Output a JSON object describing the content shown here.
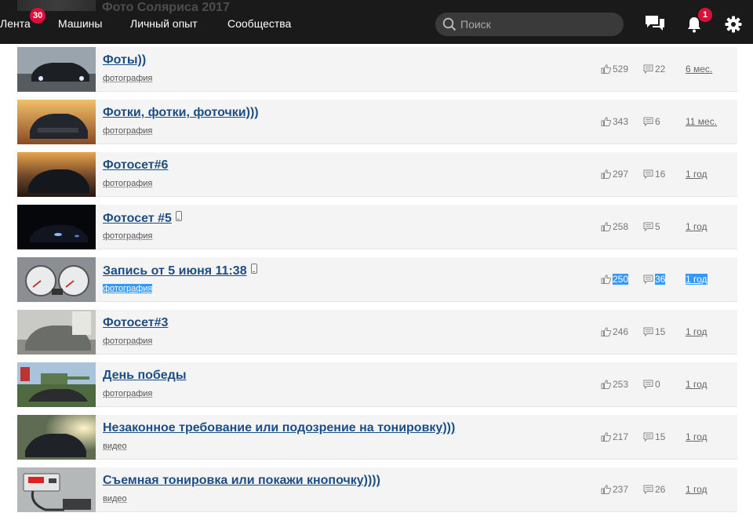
{
  "nav": {
    "items": [
      "Лента",
      "Машины",
      "Личный опыт",
      "Сообщества"
    ],
    "feed_badge": "30",
    "notifications_badge": "1",
    "search_placeholder": "Поиск",
    "ghost_title": "Фото Соляриса 2017"
  },
  "colors": {
    "accent": "#1c4e85",
    "badge": "#d9113a",
    "selection": "#3399ff",
    "topbar": "#1a1a1a"
  },
  "posts": [
    {
      "title": "Фоты))",
      "tag": "фотография",
      "likes": "529",
      "comments": "22",
      "age": "6 мес.",
      "phone": false,
      "selected": false,
      "thumb": "car-night-headlights"
    },
    {
      "title": "Фотки, фотки, фоточки)))",
      "tag": "фотография",
      "likes": "343",
      "comments": "6",
      "age": "11 мес.",
      "phone": false,
      "selected": false,
      "thumb": "car-sunset"
    },
    {
      "title": "Фотосет#6",
      "tag": "фотография",
      "likes": "297",
      "comments": "16",
      "age": "1 год",
      "phone": false,
      "selected": false,
      "thumb": "car-dusk"
    },
    {
      "title": "Фотосет #5",
      "tag": "фотография",
      "likes": "258",
      "comments": "5",
      "age": "1 год",
      "phone": true,
      "selected": false,
      "thumb": "car-dark"
    },
    {
      "title": "Запись от 5 июня 11:38",
      "tag": "фотография",
      "likes": "250",
      "comments": "36",
      "age": "1 год",
      "phone": true,
      "selected": true,
      "thumb": "dashboard"
    },
    {
      "title": "Фотосет#3",
      "tag": "фотография",
      "likes": "246",
      "comments": "15",
      "age": "1 год",
      "phone": false,
      "selected": false,
      "thumb": "car-dusty"
    },
    {
      "title": "День победы",
      "tag": "фотография",
      "likes": "253",
      "comments": "0",
      "age": "1 год",
      "phone": false,
      "selected": false,
      "thumb": "tank-memorial"
    },
    {
      "title": "Незаконное требование или подозрение на тонировку)))",
      "tag": "видео",
      "likes": "217",
      "comments": "15",
      "age": "1 год",
      "phone": false,
      "selected": false,
      "thumb": "car-sunlight"
    },
    {
      "title": "Съемная тонировка или покажи кнопочку))))",
      "tag": "видео",
      "likes": "237",
      "comments": "26",
      "age": "1 год",
      "phone": false,
      "selected": false,
      "thumb": "tint-meter"
    }
  ]
}
